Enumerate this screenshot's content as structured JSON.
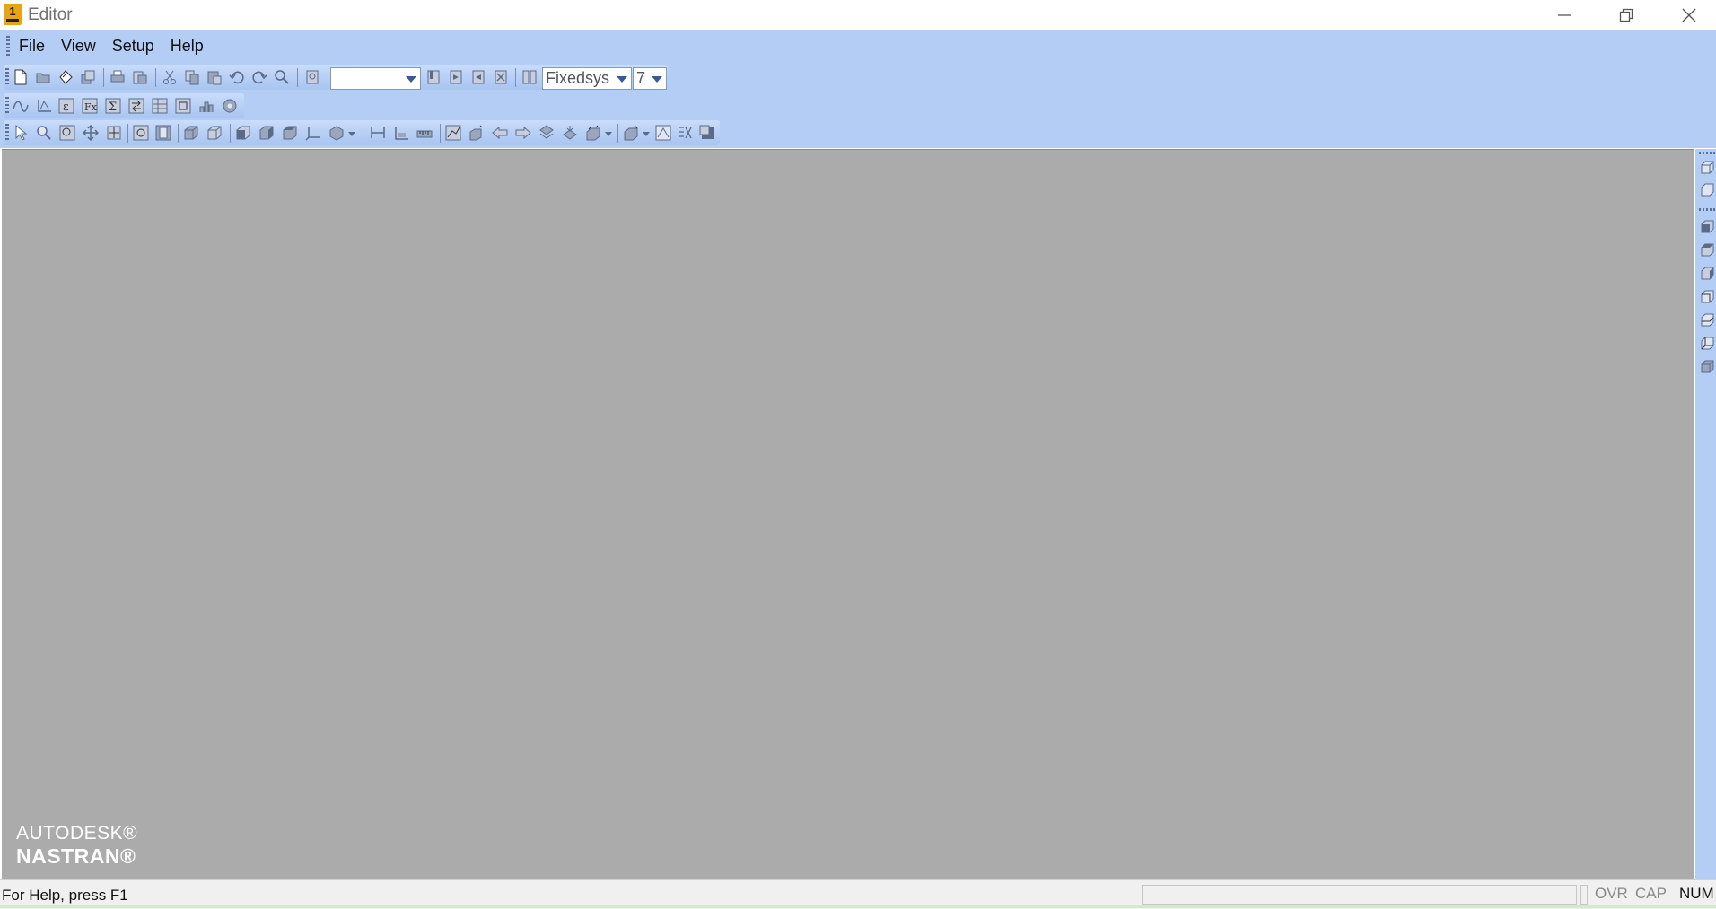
{
  "window": {
    "title": "Editor"
  },
  "menu": {
    "items": [
      "File",
      "View",
      "Setup",
      "Help"
    ]
  },
  "toolbar": {
    "style_combo_value": "",
    "font_combo_value": "Fixedsys",
    "size_combo_value": "7"
  },
  "logo": {
    "line1": "AUTODESK®",
    "line2": "NASTRAN®"
  },
  "status": {
    "help_text": "For Help, press F1",
    "indicators": {
      "ovr": "OVR",
      "cap": "CAP",
      "num": "NUM"
    }
  },
  "colors": {
    "chrome": "#b4cdf4",
    "workspace": "#ababab",
    "icon": "#5a6b88"
  }
}
